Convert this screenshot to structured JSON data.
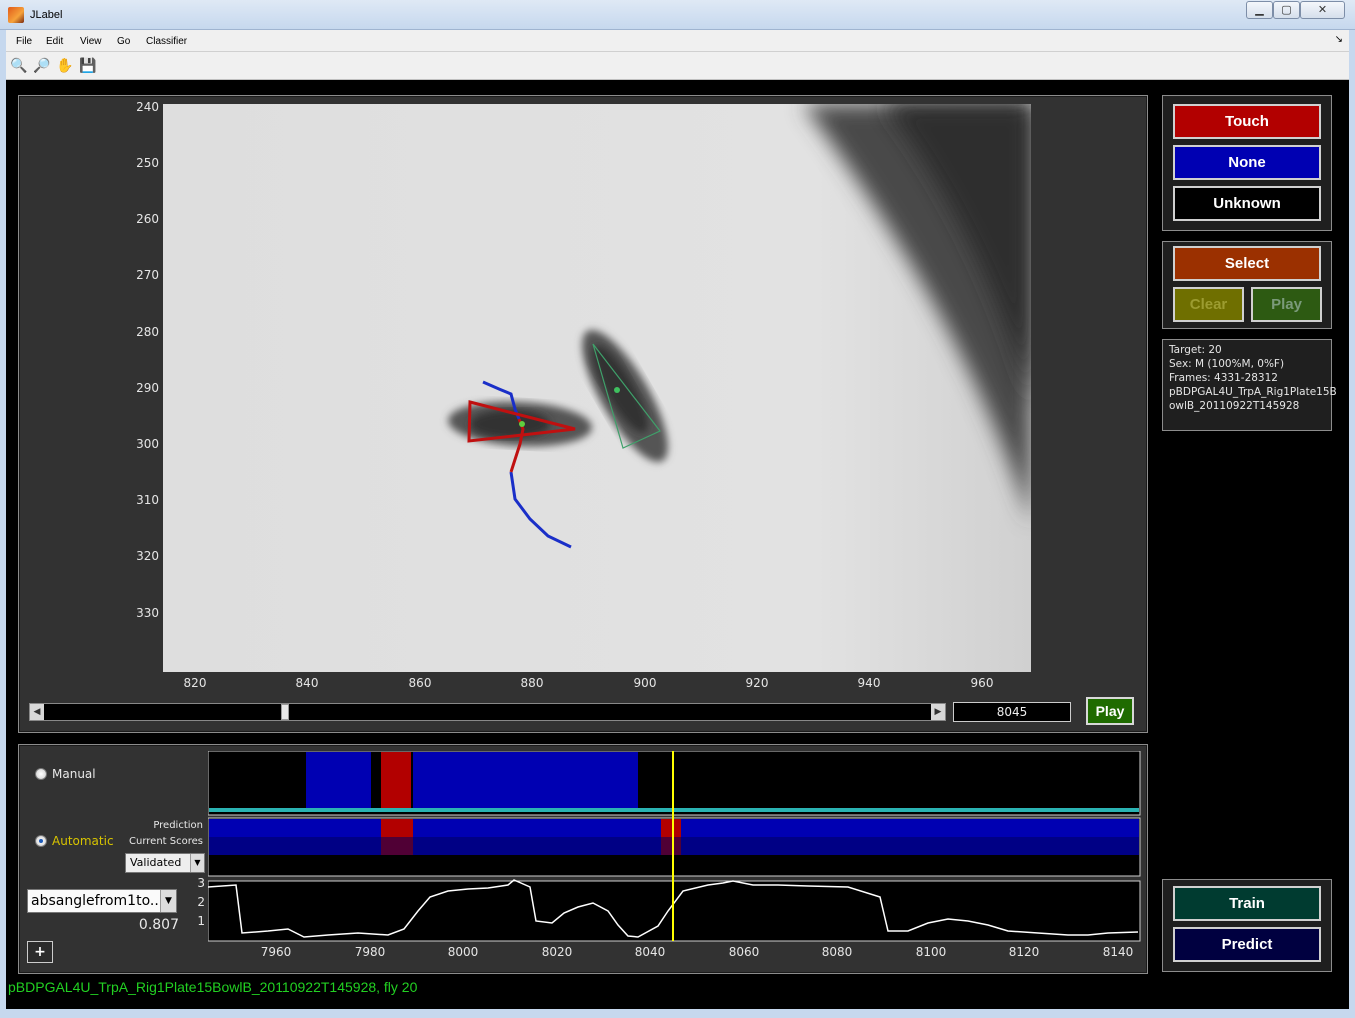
{
  "window": {
    "title": "JLabel",
    "controls": {
      "minimize": "▁",
      "maximize": "▢",
      "close": "✕"
    }
  },
  "menu": {
    "items": [
      "File",
      "Edit",
      "View",
      "Go",
      "Classifier"
    ],
    "dock": "↘"
  },
  "toolbar": {
    "tools": [
      {
        "name": "zoom-in-icon",
        "glyph": "🔍"
      },
      {
        "name": "zoom-out-icon",
        "glyph": "🔎"
      },
      {
        "name": "pan-hand-icon",
        "glyph": "✋"
      },
      {
        "name": "save-icon",
        "glyph": "💾"
      }
    ]
  },
  "video": {
    "y_ticks": [
      "240",
      "250",
      "260",
      "270",
      "280",
      "290",
      "300",
      "310",
      "320",
      "330"
    ],
    "x_ticks": [
      "820",
      "840",
      "860",
      "880",
      "900",
      "920",
      "940",
      "960"
    ],
    "frame": "8045",
    "slider_position": 0.27,
    "play_label": "Play"
  },
  "labels_panel": {
    "touch": "Touch",
    "none": "None",
    "unknown": "Unknown",
    "colors": {
      "touch": "#b20000",
      "none": "#0000b2",
      "unknown": "#000000"
    }
  },
  "select_panel": {
    "select": "Select",
    "clear": "Clear",
    "play": "Play"
  },
  "info": {
    "lines": [
      "Target: 20",
      "Sex: M (100%M, 0%F)",
      "Frames: 4331-28312",
      "pBDPGAL4U_TrpA_Rig1Plate15B",
      "owlB_20110922T145928"
    ]
  },
  "timeline": {
    "manual_label": "Manual",
    "automatic_label": "Automatic",
    "prediction_label": "Prediction",
    "scores_label": "Current Scores",
    "scores_mode": "Validated",
    "feature_name": "absanglefrom1to...",
    "feature_value": "0.807",
    "plus_label": "+",
    "x_ticks": [
      "7960",
      "7980",
      "8000",
      "8020",
      "8040",
      "8060",
      "8080",
      "8100",
      "8120",
      "8140"
    ],
    "y_ticks": [
      "3",
      "2",
      "1"
    ]
  },
  "train_panel": {
    "train": "Train",
    "predict": "Predict"
  },
  "status": "pBDPGAL4U_TrpA_Rig1Plate15BowlB_20110922T145928, fly 20"
}
